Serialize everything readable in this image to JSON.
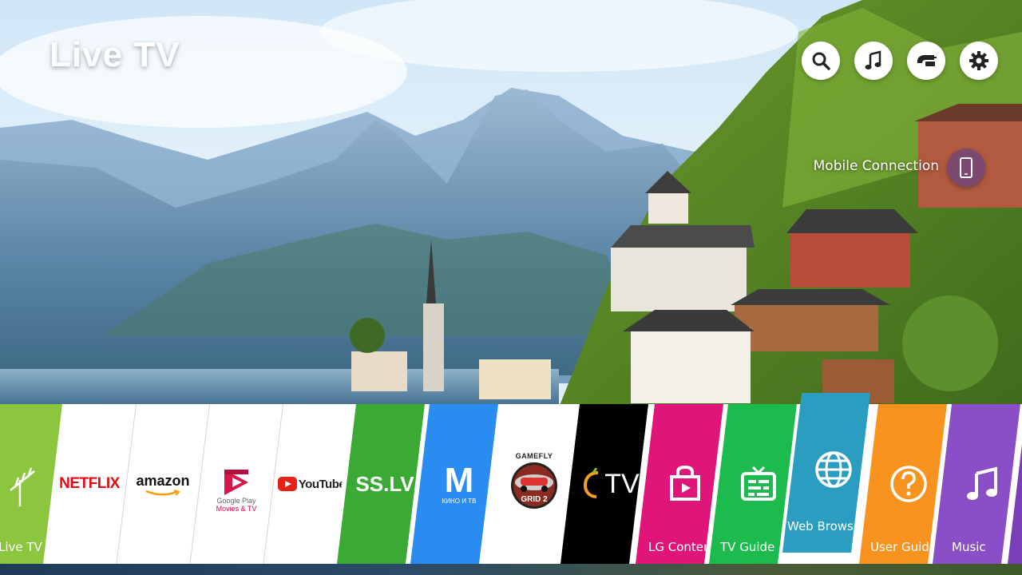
{
  "header": {
    "title": "Live TV"
  },
  "top_buttons": [
    {
      "name": "search",
      "icon": "search-icon"
    },
    {
      "name": "music",
      "icon": "music-note-icon"
    },
    {
      "name": "input",
      "icon": "input-cable-icon"
    },
    {
      "name": "settings",
      "icon": "gear-icon"
    }
  ],
  "mobile": {
    "label": "Mobile Connection",
    "icon": "smartphone-icon",
    "color": "#7b4a6e"
  },
  "launcher": {
    "tiles": [
      {
        "label": "Live TV",
        "color": "#8cc63f",
        "icon": "antenna-icon"
      },
      {
        "label": "",
        "logo": "NETFLIX",
        "color": "#ffffff"
      },
      {
        "label": "",
        "logo": "amazon",
        "color": "#ffffff"
      },
      {
        "label": "",
        "logo_line1": "Google Play",
        "logo_line2": "Movies & TV",
        "color": "#ffffff"
      },
      {
        "label": "",
        "logo": "YouTube",
        "color": "#ffffff"
      },
      {
        "label": "",
        "logo": "SS.LV",
        "color": "#3aaa35"
      },
      {
        "label": "",
        "logo": "M",
        "logo_sub": "КИНО И ТВ",
        "color": "#2a8cf0"
      },
      {
        "label": "",
        "logo": "GAMEFLY",
        "logo_sub": "GRID 2",
        "color": "#ffffff"
      },
      {
        "label": "",
        "logo": "TV",
        "color": "#000000"
      },
      {
        "label": "LG Content Store",
        "color": "#e0157a",
        "icon": "shopping-bag-icon"
      },
      {
        "label": "TV Guide",
        "color": "#1dbb4e",
        "icon": "tv-guide-icon"
      },
      {
        "label": "Web Browser",
        "color": "#2b9dc0",
        "icon": "globe-icon"
      },
      {
        "label": "User Guide",
        "color": "#f7931e",
        "icon": "question-icon"
      },
      {
        "label": "Music",
        "color": "#8a4ec7",
        "icon": "music-note-icon"
      },
      {
        "label": "",
        "color": "#7a3fb8"
      }
    ]
  }
}
